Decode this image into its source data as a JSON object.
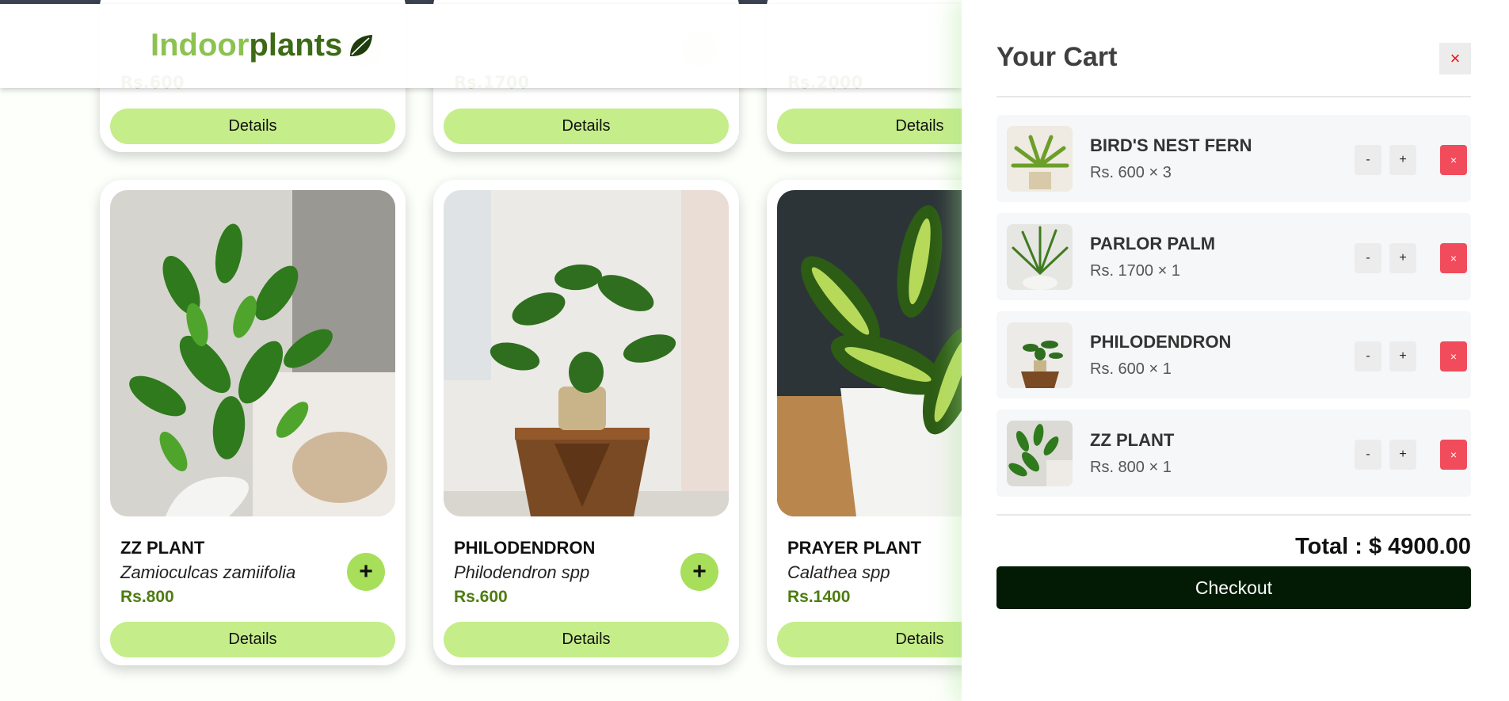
{
  "brand": {
    "part1": "Indoor",
    "part2": "plants",
    "icon": "leaf-icon"
  },
  "top_cards": [
    {
      "price": "Rs.600",
      "details_label": "Details"
    },
    {
      "price": "Rs.1700",
      "details_label": "Details"
    },
    {
      "price": "Rs.2000",
      "details_label": "Details"
    }
  ],
  "products": [
    {
      "name": "ZZ PLANT",
      "scientific": "Zamioculcas zamiifolia",
      "price": "Rs.800",
      "add_label": "+",
      "details_label": "Details"
    },
    {
      "name": "PHILODENDRON",
      "scientific": "Philodendron spp",
      "price": "Rs.600",
      "add_label": "+",
      "details_label": "Details"
    },
    {
      "name": "PRAYER PLANT",
      "scientific": "Calathea spp",
      "price": "Rs.1400",
      "add_label": "+",
      "details_label": "Details"
    }
  ],
  "cart": {
    "title": "Your Cart",
    "close_label": "×",
    "items": [
      {
        "name": "BIRD'S NEST FERN",
        "price_qty": "Rs. 600 × 3",
        "minus": "-",
        "plus": "+",
        "remove": "×"
      },
      {
        "name": "PARLOR PALM",
        "price_qty": "Rs. 1700 × 1",
        "minus": "-",
        "plus": "+",
        "remove": "×"
      },
      {
        "name": "PHILODENDRON",
        "price_qty": "Rs. 600 × 1",
        "minus": "-",
        "plus": "+",
        "remove": "×"
      },
      {
        "name": "ZZ PLANT",
        "price_qty": "Rs. 800 × 1",
        "minus": "-",
        "plus": "+",
        "remove": "×"
      }
    ],
    "total": "Total : $ 4900.00",
    "checkout_label": "Checkout"
  },
  "colors": {
    "accent": "#c5ed8a",
    "price_green": "#4e7c11",
    "checkout_bg": "#031b05",
    "remove_red": "#f14c5b"
  }
}
